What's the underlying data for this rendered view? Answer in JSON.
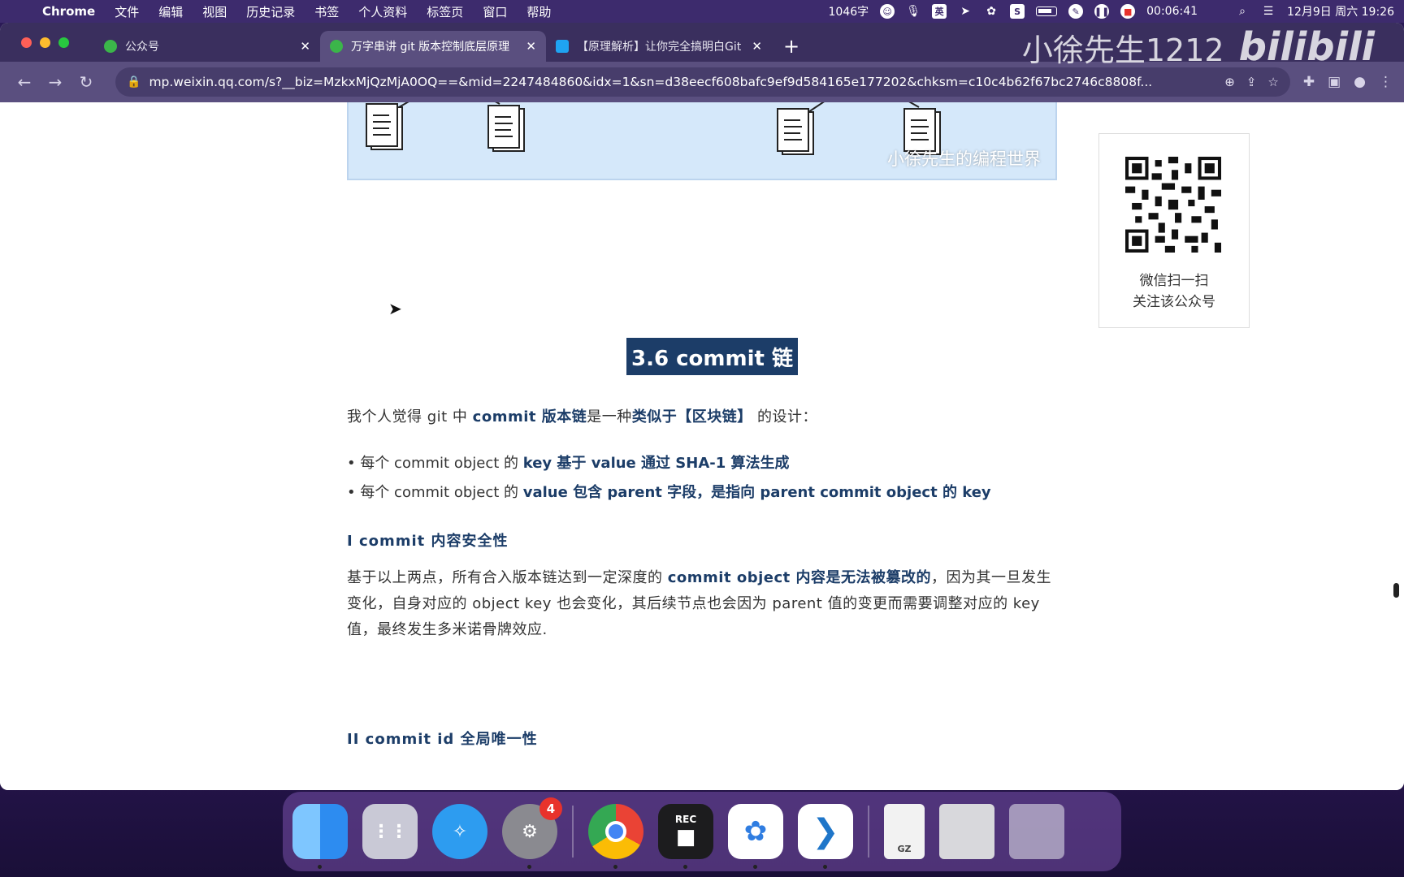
{
  "menubar": {
    "app": "Chrome",
    "items": [
      "文件",
      "编辑",
      "视图",
      "历史记录",
      "书签",
      "个人资料",
      "标签页",
      "窗口",
      "帮助"
    ],
    "word_count": "1046字",
    "ime": "英",
    "timer": "00:06:41",
    "datetime": "12月9日 周六  19:26"
  },
  "tabs": [
    {
      "title": "公众号",
      "favicon_color": "#3bb54a"
    },
    {
      "title": "万字串讲 git 版本控制底层原理",
      "favicon_color": "#3bb54a"
    },
    {
      "title": "【原理解析】让你完全搞明白Git",
      "favicon_color": "#1fa3f2"
    }
  ],
  "watermark": {
    "user": "小徐先生1212",
    "brand": "bilibili"
  },
  "omnibox": {
    "url": "mp.weixin.qq.com/s?__biz=MzkxMjQzMjA0OQ==&mid=2247484860&idx=1&sn=d38eecf608bafc9ef9d584165e177202&chksm=c10c4b62f67bc2746c8808f..."
  },
  "figure": {
    "watermark": "小徐先生的编程世界"
  },
  "qr_card": {
    "line1": "微信扫一扫",
    "line2": "关注该公众号"
  },
  "article": {
    "heading": "3.6 commit 链",
    "intro_pre": "我个人觉得 git 中 ",
    "intro_b1": "commit 版本链",
    "intro_mid": "是一种",
    "intro_b2": "类似于【区块链】",
    "intro_post": " 的设计：",
    "bullet1_pre": "• 每个 commit object 的 ",
    "bullet1_b": "key 基于 value 通过 SHA-1 算法生成",
    "bullet2_pre": "• 每个 commit object 的 ",
    "bullet2_b": "value 包含 parent 字段，是指向 parent commit object 的 key",
    "sub1": "I commit 内容安全性",
    "para2_pre": "基于以上两点，所有合入版本链达到一定深度的 ",
    "para2_b": "commit object 内容是无法被篡改的",
    "para2_post": "，因为其一旦发生变化，自身对应的 object key 也会变化，其后续节点也会因为 parent 值的变更而需要调整对应的 key 值，最终发生多米诺骨牌效应.",
    "sub2": "II commit id 全局唯一性"
  },
  "dock": {
    "badge_count": "4",
    "rec_label": "REC",
    "gz_label": "GZ"
  },
  "colors": {
    "accent": "#1c3d68",
    "tab_active": "#5a4f7f",
    "tabstrip": "#3a2f5e"
  }
}
